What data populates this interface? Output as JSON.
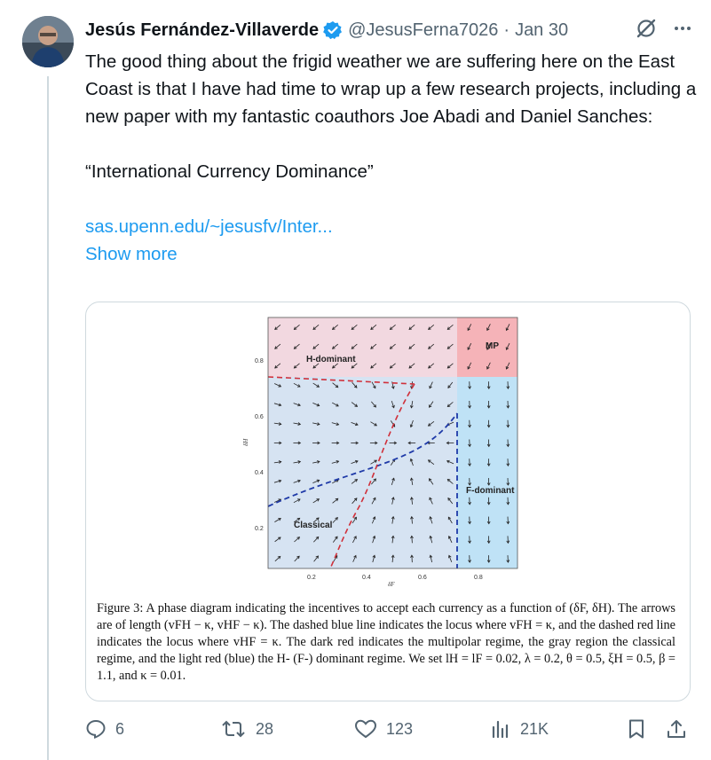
{
  "author": {
    "name": "Jesús Fernández-Villaverde",
    "handle": "@JesusFerna7026",
    "separator": "·",
    "date": "Jan 30",
    "verified_color": "#1d9bf0"
  },
  "tweet": {
    "paragraph1": "The good thing about the frigid weather we are suffering here on the East Coast is that I have had time to wrap up a few research projects, including a new paper with my fantastic coauthors Joe Abadi and Daniel Sanches:",
    "paper_title": "“International Currency Dominance”",
    "link": "sas.upenn.edu/~jesusfv/Inter...",
    "show_more": "Show more"
  },
  "figure": {
    "region_labels": {
      "h_dominant": "H-dominant",
      "mp": "MP",
      "classical": "Classical",
      "f_dominant": "F-dominant"
    },
    "x_axis_label": "δF",
    "y_axis_label": "δH",
    "x_ticks": [
      "0.2",
      "0.4",
      "0.6",
      "0.8"
    ],
    "y_ticks": [
      "0.2",
      "0.4",
      "0.6",
      "0.8"
    ],
    "colors": {
      "h_dominant": "#f2d8e0",
      "mp": "#f5b3b8",
      "classical": "#d6e3f2",
      "f_dominant": "#bfe2f6",
      "blue_locus": "#1f3aa8",
      "red_locus": "#d0303a"
    },
    "caption": "Figure 3: A phase diagram indicating the incentives to accept each currency as a function of (δF, δH). The arrows are of length (vFH − κ, vHF − κ). The dashed blue line indicates the locus where vFH = κ, and the dashed red line indicates the locus where vHF = κ. The dark red indicates the multipolar regime, the gray region the classical regime, and the light red (blue) the H- (F-) dominant regime. We set lH = lF = 0.02, λ = 0.2, θ = 0.5, ξH = 0.5, β = 1.1, and κ = 0.01."
  },
  "actions": {
    "replies": "6",
    "reposts": "28",
    "likes": "123",
    "views": "21K"
  },
  "icons": [
    "verified-badge-icon",
    "grok-icon",
    "more-icon",
    "reply-icon",
    "repost-icon",
    "like-icon",
    "views-icon",
    "bookmark-icon",
    "share-icon"
  ]
}
